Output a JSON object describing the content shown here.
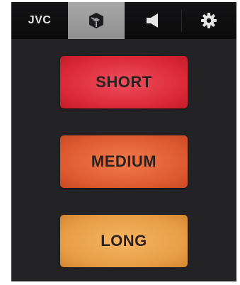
{
  "header": {
    "brand": "JVC",
    "tabs": [
      {
        "icon": "cube-icon",
        "active": true
      },
      {
        "icon": "speaker-icon",
        "active": false
      },
      {
        "icon": "gear-icon",
        "active": false
      }
    ]
  },
  "buttons": {
    "short": "SHORT",
    "medium": "MEDIUM",
    "long": "LONG"
  },
  "colors": {
    "short": "#dc2837",
    "medium": "#de5a30",
    "long": "#e79c44",
    "active_tab": "#9a9a9a",
    "background": "#232325"
  }
}
